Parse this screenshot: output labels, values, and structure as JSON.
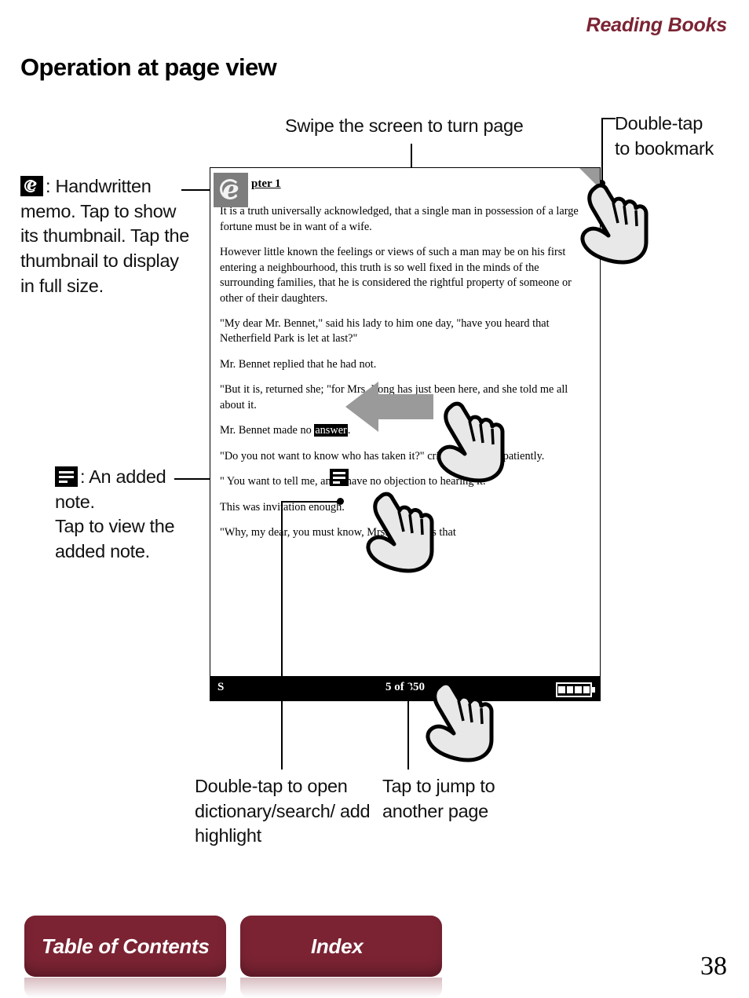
{
  "header": {
    "section_title": "Reading Books"
  },
  "page": {
    "title": "Operation at page view",
    "folio": "38"
  },
  "callouts": {
    "swipe": "Swipe the screen to turn page",
    "bookmark": "Double-tap\nto bookmark",
    "memo_icon_name": "handwritten-memo-icon",
    "memo": ": Handwritten memo. Tap to show its thumbnail. Tap the thumbnail to display in full size.",
    "note_icon_name": "added-note-icon",
    "note": ": An added note.\nTap to view the added note.",
    "dictionary": "Double-tap to open dictionary/search/ add highlight",
    "jump": "Tap to jump to another page"
  },
  "device": {
    "chapter_heading": "pter 1",
    "paragraphs": [
      "It is a truth universally acknowledged, that a single man in possession of a large fortune must be in want of a wife.",
      "However little known the feelings or views of such a man may be on his first entering a neighbourhood, this truth is so well fixed in the minds of the surrounding families, that he is considered the rightful property of someone or other of their daughters.",
      "\"My dear Mr. Bennet,\" said his lady to him one day, \"have you heard that Netherfield Park is let at last?\"",
      "Mr. Bennet replied that he had not.",
      "\"But it is, returned she; \"for Mrs. Long has just been here, and she told me all about it.",
      "\"Do you not want to know who has taken it?\" cried his wife impatiently.",
      "\" You want to tell me, and I have no objection to hearing it.\"",
      "This was invitation enough.",
      "\"Why, my dear, you must know, Mrs. Long says that"
    ],
    "note_paragraph_prefix": "Mr. Bennet made no ",
    "note_paragraph_highlight": "answer",
    "note_paragraph_suffix": ".",
    "status_left": "S",
    "status_center": "5 of 350",
    "battery_icon_name": "battery-icon"
  },
  "footer": {
    "table_of_contents": "Table of Contents",
    "index": "Index"
  },
  "colors": {
    "accent": "#7b2333",
    "memo_stamp": "#7d7d7d",
    "arrow": "#9a9a9a"
  }
}
